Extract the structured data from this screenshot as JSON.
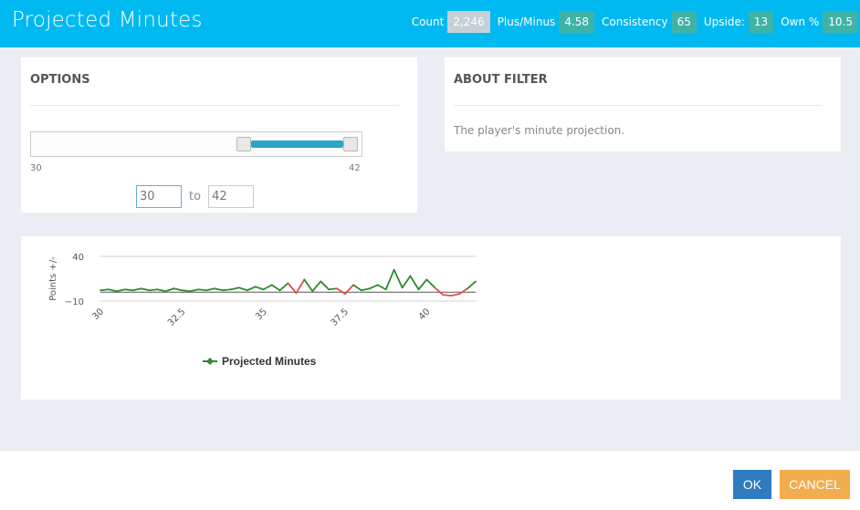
{
  "header": {
    "title": "Projected Minutes",
    "stats": [
      {
        "label": "Count",
        "value": "2,246"
      },
      {
        "label": "Plus/Minus",
        "value": "4.58"
      },
      {
        "label": "Consistency",
        "value": "65"
      },
      {
        "label": "Upside:",
        "value": "13"
      },
      {
        "label": "Own %",
        "value": "10.5"
      }
    ]
  },
  "options": {
    "title": "OPTIONS",
    "slider": {
      "min_label": "30",
      "max_label": "42",
      "min": 30,
      "max": 42,
      "low": 30,
      "high": 42
    },
    "from_value": "30",
    "to_label": "to",
    "to_value": "42"
  },
  "about": {
    "title": "ABOUT FILTER",
    "text": "The player's minute projection."
  },
  "chart_data": {
    "type": "line",
    "ylabel": "Points +/-",
    "y_ticks": [
      "40",
      "−10"
    ],
    "ylim": [
      -10,
      40
    ],
    "x_ticks": [
      "30",
      "32.5",
      "35",
      "37.5",
      "40"
    ],
    "xlim": [
      30,
      41.5
    ],
    "legend": "Projected Minutes",
    "series": [
      {
        "name": "Projected Minutes",
        "x": [
          30,
          30.25,
          30.5,
          30.75,
          31,
          31.25,
          31.5,
          31.75,
          32,
          32.25,
          32.5,
          32.75,
          33,
          33.25,
          33.5,
          33.75,
          34,
          34.25,
          34.5,
          34.75,
          35,
          35.25,
          35.5,
          35.75,
          36,
          36.25,
          36.5,
          36.75,
          37,
          37.25,
          37.5,
          37.75,
          38,
          38.25,
          38.5,
          38.75,
          39,
          39.25,
          39.5,
          39.75,
          40,
          40.25,
          40.5,
          40.75,
          41,
          41.25,
          41.5
        ],
        "values": [
          2,
          3,
          1,
          3,
          2,
          4,
          2,
          3,
          1,
          4,
          2,
          1,
          3,
          2,
          4,
          2,
          3,
          5,
          2,
          6,
          3,
          8,
          2,
          10,
          -1,
          14,
          1,
          12,
          3,
          4,
          -2,
          8,
          2,
          4,
          8,
          3,
          25,
          5,
          18,
          3,
          14,
          5,
          -3,
          -4,
          -2,
          4,
          12
        ]
      }
    ],
    "colors": {
      "positive": "#2d8a2d",
      "negative": "#e84a4a",
      "grid": "#d0d0d0",
      "zero": "#555555"
    }
  },
  "footer": {
    "ok_label": "OK",
    "cancel_label": "CANCEL"
  }
}
